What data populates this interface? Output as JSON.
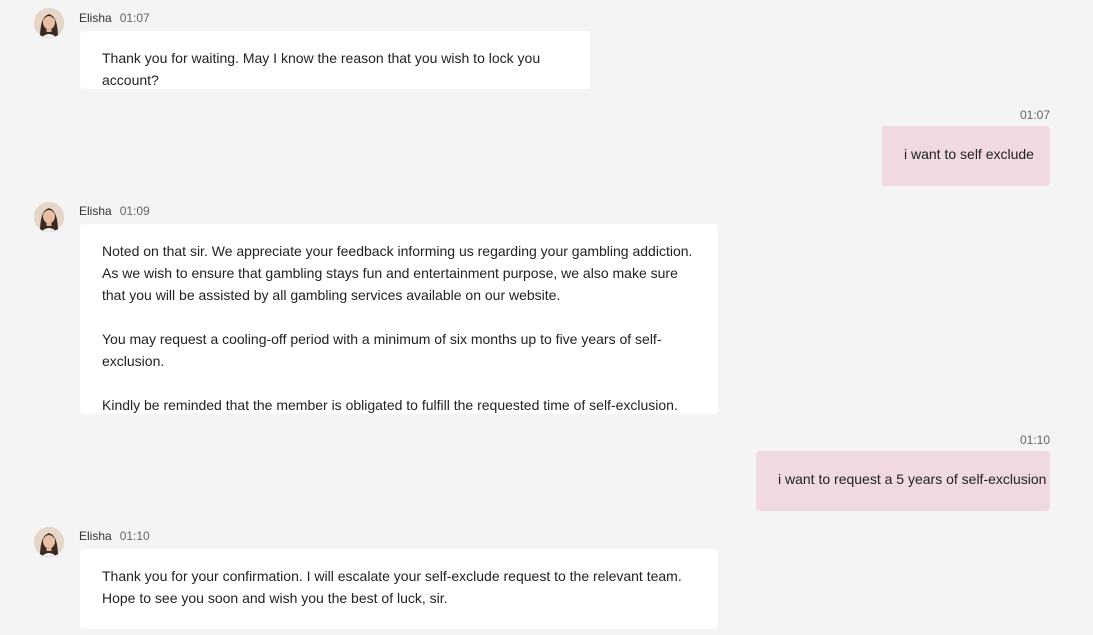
{
  "messages": [
    {
      "sender": "Elisha",
      "time": "01:07",
      "paragraphs": [
        "Thank you for waiting. May I know the reason that you wish to lock you account?"
      ]
    },
    {
      "sender": "user",
      "time": "01:07",
      "text": "i want to self exclude"
    },
    {
      "sender": "Elisha",
      "time": "01:09",
      "paragraphs": [
        "Noted on that sir. We appreciate your feedback informing us regarding your gambling addiction. As we wish to ensure that gambling stays fun and entertainment purpose, we also make sure that you will be assisted by all gambling services available on our website.",
        "You may request a cooling-off period with a minimum of six months up to five years of self-exclusion.",
        "Kindly be reminded that the member is obligated to fulfill the requested time of self-exclusion."
      ]
    },
    {
      "sender": "user",
      "time": "01:10",
      "text": "i want to request a 5 years of self-exclusion"
    },
    {
      "sender": "Elisha",
      "time": "01:10",
      "paragraphs": [
        "Thank you for your confirmation. I will escalate your self-exclude request to the relevant team. Hope to see you soon and wish you the best of luck, sir."
      ]
    }
  ]
}
